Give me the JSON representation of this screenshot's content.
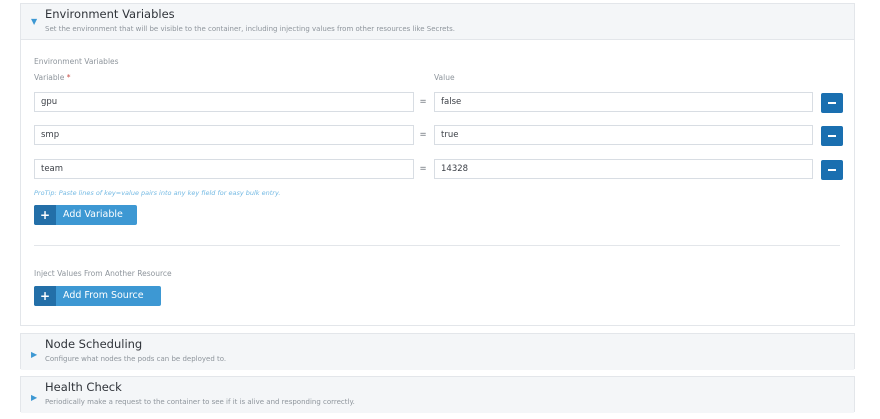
{
  "env_panel": {
    "title": "Environment Variables",
    "description": "Set the environment that will be visible to the container, including injecting values from other resources like Secrets.",
    "section_label": "Environment Variables",
    "variable_col": "Variable",
    "required_mark": "*",
    "value_col": "Value",
    "rows": [
      {
        "key": "gpu",
        "eq": "=",
        "value": "false"
      },
      {
        "key": "smp",
        "eq": "=",
        "value": "true"
      },
      {
        "key": "team",
        "eq": "=",
        "value": "14328"
      }
    ],
    "protip": "ProTip: Paste lines of key=value pairs into any key field for easy bulk entry.",
    "add_variable_label": "Add Variable",
    "inject_label": "Inject Values From Another Resource",
    "add_from_source_label": "Add From Source"
  },
  "node_panel": {
    "title": "Node Scheduling",
    "description": "Configure what nodes the pods can be deployed to."
  },
  "health_panel": {
    "title": "Health Check",
    "description": "Periodically make a request to the container to see if it is alive and responding correctly."
  },
  "icons": {
    "expanded": "caret-down-icon",
    "collapsed": "caret-right-icon",
    "remove": "minus-icon",
    "add": "plus-icon"
  },
  "colors": {
    "accent": "#3d98d3",
    "accent_dark": "#1a6fb0",
    "header_bg": "#f4f6f8",
    "protip": "#73b9e3"
  }
}
